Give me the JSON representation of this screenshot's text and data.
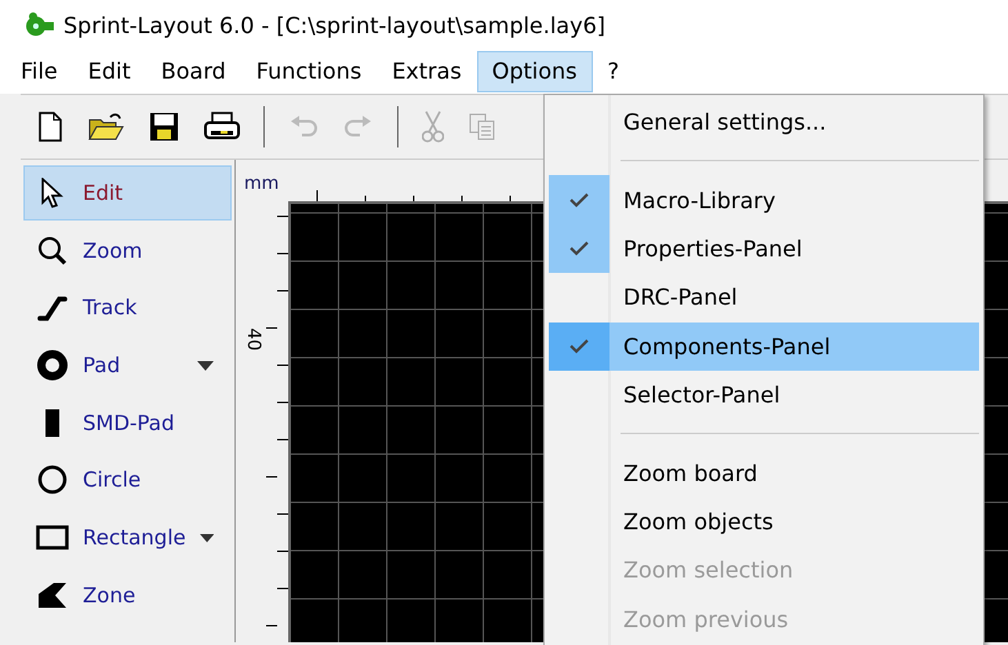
{
  "window": {
    "title": "Sprint-Layout 6.0 - [C:\\sprint-layout\\sample.lay6]"
  },
  "menu_bar": [
    {
      "label": "File",
      "selected": false
    },
    {
      "label": "Edit",
      "selected": false
    },
    {
      "label": "Board",
      "selected": false
    },
    {
      "label": "Functions",
      "selected": false
    },
    {
      "label": "Extras",
      "selected": false
    },
    {
      "label": "Options",
      "selected": true
    },
    {
      "label": "?",
      "selected": false
    }
  ],
  "toolbar": [
    {
      "kind": "new",
      "disabled": false
    },
    {
      "kind": "open",
      "disabled": false
    },
    {
      "kind": "save",
      "disabled": false
    },
    {
      "kind": "print",
      "disabled": false
    },
    {
      "kind": "separator"
    },
    {
      "kind": "undo",
      "disabled": true
    },
    {
      "kind": "redo",
      "disabled": true
    },
    {
      "kind": "separator"
    },
    {
      "kind": "cut",
      "disabled": true
    },
    {
      "kind": "copy",
      "disabled": true
    }
  ],
  "tools": [
    {
      "kind": "edit",
      "label": "Edit",
      "selected": true,
      "dropdown": false
    },
    {
      "kind": "zoom",
      "label": "Zoom",
      "selected": false,
      "dropdown": false
    },
    {
      "kind": "track",
      "label": "Track",
      "selected": false,
      "dropdown": false
    },
    {
      "kind": "pad",
      "label": "Pad",
      "selected": false,
      "dropdown": true
    },
    {
      "kind": "smd",
      "label": "SMD-Pad",
      "selected": false,
      "dropdown": false
    },
    {
      "kind": "circle",
      "label": "Circle",
      "selected": false,
      "dropdown": false
    },
    {
      "kind": "rectangle",
      "label": "Rectangle",
      "selected": false,
      "dropdown": true
    },
    {
      "kind": "zone",
      "label": "Zone",
      "selected": false,
      "dropdown": false
    }
  ],
  "canvas": {
    "unit": "mm",
    "ruler_label": "40"
  },
  "options_menu": [
    {
      "kind": "item",
      "label": "General settings...",
      "checked": false,
      "selected": false,
      "disabled": false
    },
    {
      "kind": "separator"
    },
    {
      "kind": "item",
      "label": "Macro-Library",
      "checked": true,
      "selected": false,
      "disabled": false
    },
    {
      "kind": "item",
      "label": "Properties-Panel",
      "checked": true,
      "selected": false,
      "disabled": false
    },
    {
      "kind": "item",
      "label": "DRC-Panel",
      "checked": false,
      "selected": false,
      "disabled": false
    },
    {
      "kind": "item",
      "label": "Components-Panel",
      "checked": true,
      "selected": true,
      "disabled": false
    },
    {
      "kind": "item",
      "label": "Selector-Panel",
      "checked": false,
      "selected": false,
      "disabled": false
    },
    {
      "kind": "separator"
    },
    {
      "kind": "item",
      "label": "Zoom board",
      "checked": false,
      "selected": false,
      "disabled": false
    },
    {
      "kind": "item",
      "label": "Zoom objects",
      "checked": false,
      "selected": false,
      "disabled": false
    },
    {
      "kind": "item",
      "label": "Zoom selection",
      "checked": false,
      "selected": false,
      "disabled": true
    },
    {
      "kind": "item",
      "label": "Zoom previous",
      "checked": false,
      "selected": false,
      "disabled": true
    }
  ]
}
